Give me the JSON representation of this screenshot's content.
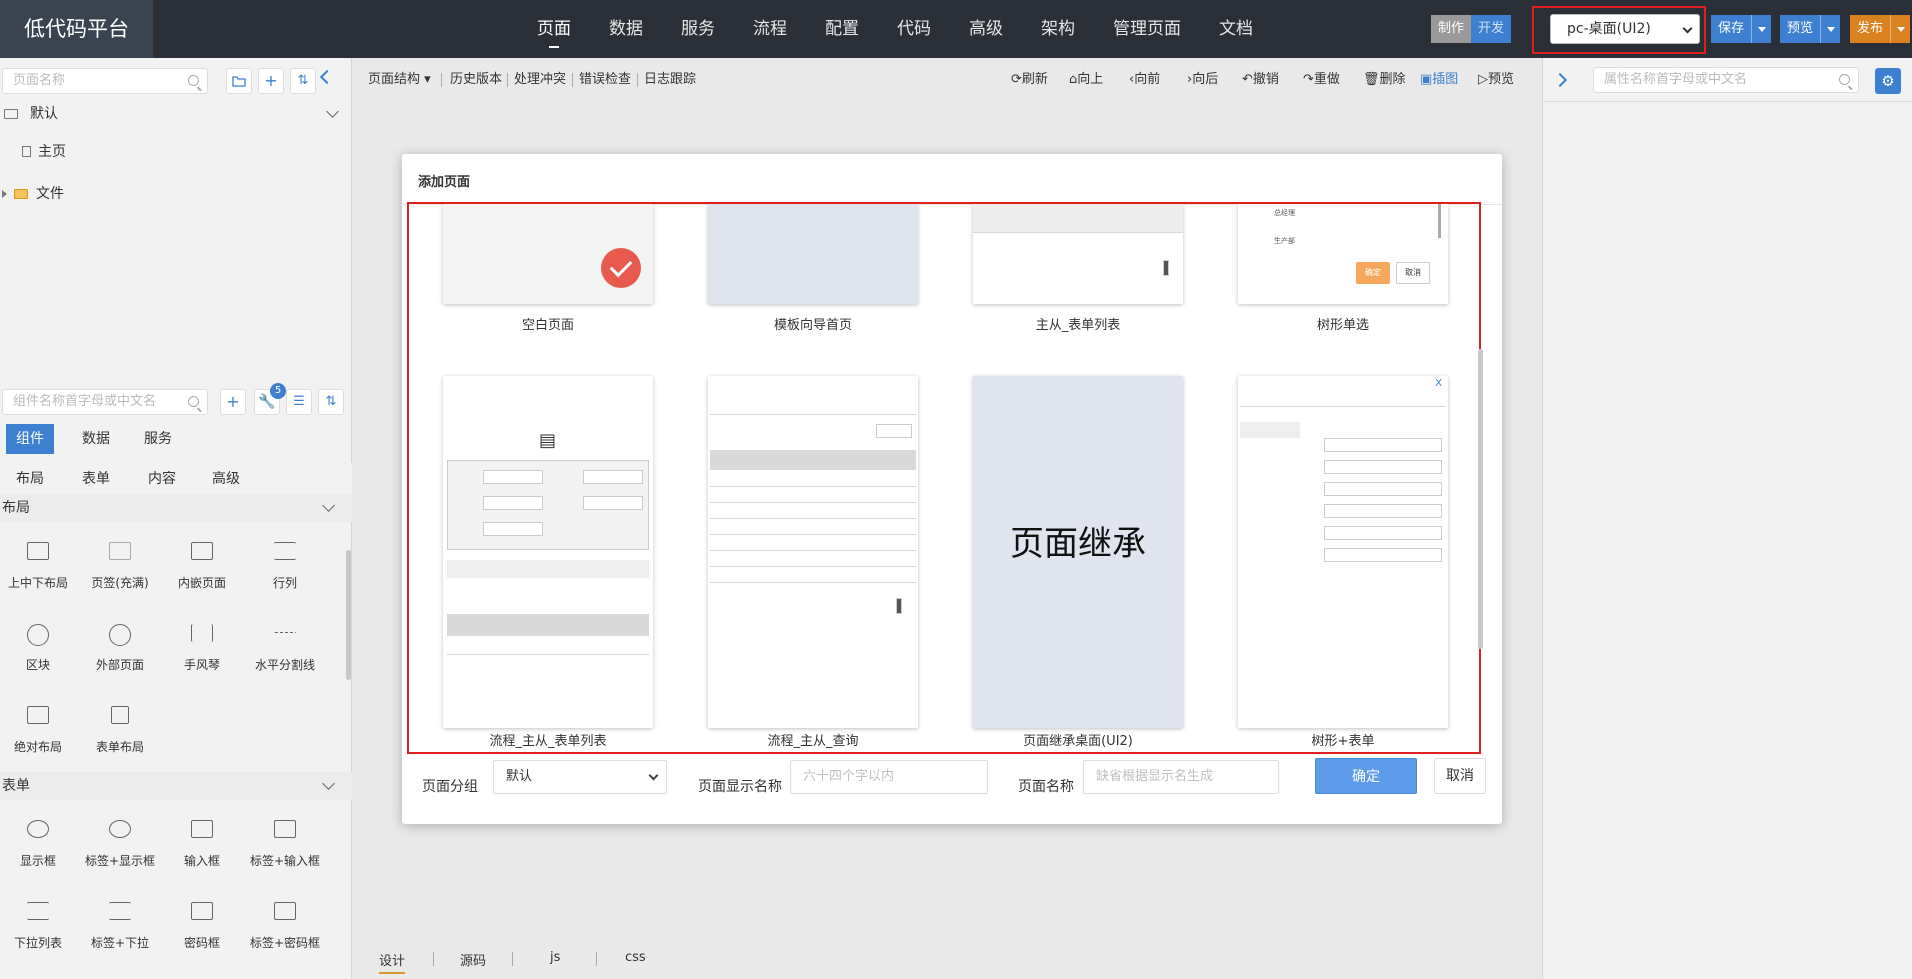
{
  "app": {
    "logo": "低代码平台"
  },
  "nav": [
    "页面",
    "数据",
    "服务",
    "流程",
    "配置",
    "代码",
    "高级",
    "架构",
    "管理页面",
    "文档"
  ],
  "mode": {
    "make": "制作",
    "dev": "开发"
  },
  "platform": {
    "selected": "pc-桌面(UI2)"
  },
  "actions": {
    "save": "保存",
    "preview": "预览",
    "publish": "发布"
  },
  "left": {
    "page_search_placeholder": "页面名称",
    "tree": {
      "default_group": "默认",
      "main_page": "主页",
      "file_folder": "文件"
    },
    "comp_search_placeholder": "组件名称首字母或中文名",
    "badge": "5",
    "tabs": [
      "组件",
      "数据",
      "服务"
    ],
    "subtabs": [
      "布局",
      "表单",
      "内容",
      "高级"
    ],
    "section_layout": "布局",
    "layout_items": [
      "上中下布局",
      "页签(充满)",
      "内嵌页面",
      "行列",
      "区块",
      "外部页面",
      "手风琴",
      "水平分割线",
      "绝对布局",
      "表单布局"
    ],
    "section_form": "表单",
    "form_items": [
      "显示框",
      "标签+显示框",
      "输入框",
      "标签+输入框",
      "下拉列表",
      "标签+下拉",
      "密码框",
      "标签+密码框"
    ]
  },
  "toolbar": {
    "left": [
      "页面结构",
      "历史版本",
      "处理冲突",
      "错误检查",
      "日志跟踪"
    ],
    "right": [
      "刷新",
      "向上",
      "向前",
      "向后",
      "撤销",
      "重做",
      "删除",
      "插图",
      "预览"
    ]
  },
  "right": {
    "search_placeholder": "属性名称首字母或中文名"
  },
  "bottom_tabs": [
    "设计",
    "源码",
    "js",
    "css"
  ],
  "modal": {
    "title": "添加页面",
    "templates": [
      "空白页面",
      "模板向导首页",
      "主从_表单列表",
      "树形单选",
      "流程_主从_表单列表",
      "流程_主从_查询",
      "页面继承桌面(UI2)",
      "树形+表单"
    ],
    "inherit_thumb_text": "页面继承",
    "tree_thumb": {
      "node1": "总经理",
      "node2": "生产部",
      "ok": "确定",
      "cancel": "取消"
    },
    "group_label": "页面分组",
    "group_value": "默认",
    "display_name_label": "页面显示名称",
    "display_name_placeholder": "六十四个字以内",
    "page_name_label": "页面名称",
    "page_name_placeholder": "缺省根据显示名生成",
    "ok": "确定",
    "cancel": "取消"
  }
}
